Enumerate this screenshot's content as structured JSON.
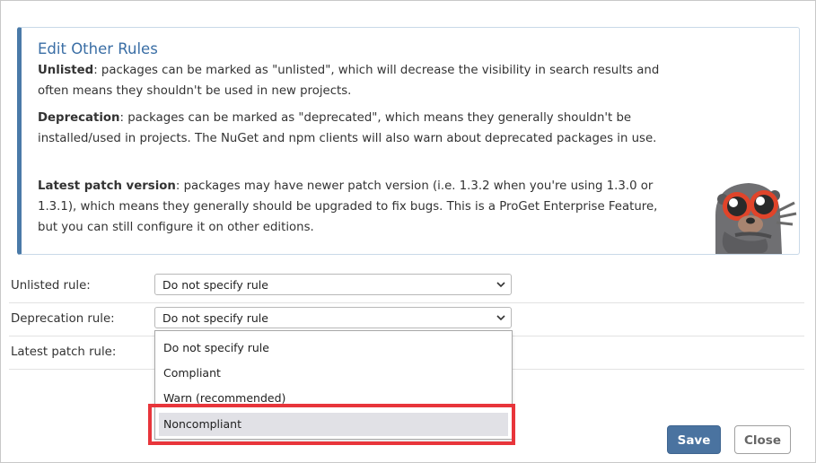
{
  "info": {
    "title": "Edit Other Rules",
    "unlisted": {
      "term": "Unlisted",
      "text": ": packages can be marked as \"unlisted\", which will decrease the visibility in search results and often means they shouldn't be used in new projects."
    },
    "deprecation": {
      "term": "Deprecation",
      "text": ": packages can be marked as \"deprecated\", which means they generally shouldn't be installed/used in projects. The NuGet and npm clients will also warn about deprecated packages in use."
    },
    "latest_patch": {
      "term": "Latest patch version",
      "text": ": packages may have newer patch version (i.e. 1.3.2 when you're using 1.3.0 or 1.3.1), which means they generally should be upgraded to fix bugs. This is a ProGet Enterprise Feature, but you can still configure it on other editions."
    },
    "mascot_icon": "otter-mascot-icon"
  },
  "form": {
    "unlisted": {
      "label": "Unlisted rule:",
      "value": "Do not specify rule"
    },
    "deprecation": {
      "label": "Deprecation rule:",
      "value": "Do not specify rule"
    },
    "latest_patch": {
      "label": "Latest patch rule:"
    }
  },
  "dropdown": {
    "options": [
      "Do not specify rule",
      "Compliant",
      "Warn (recommended)",
      "Noncompliant"
    ],
    "hovered_index": 3,
    "highlight_color": "#e8353b"
  },
  "buttons": {
    "save": "Save",
    "close": "Close"
  },
  "colors": {
    "accent": "#4a73a0",
    "title": "#3a6ea5"
  }
}
